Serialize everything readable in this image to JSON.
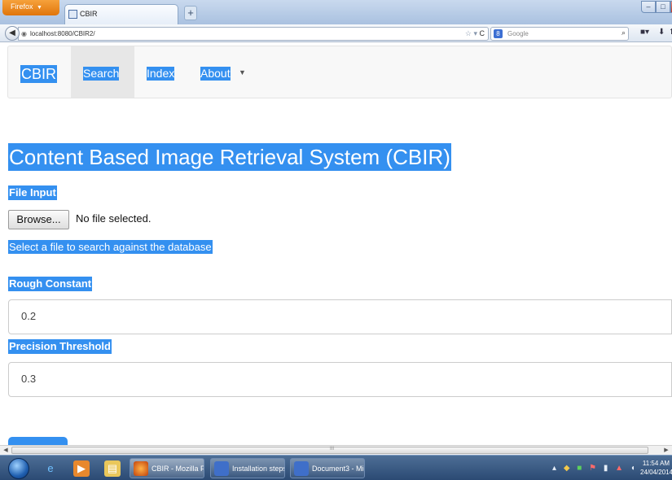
{
  "browser": {
    "app_button_label": "Firefox",
    "tab_title": "CBIR",
    "new_tab_label": "+",
    "url": "localhost:8080/CBIR2/",
    "search_engine_badge": "8",
    "search_placeholder": "Google",
    "icons": [
      "back-icon",
      "globe-icon",
      "star-icon",
      "reload-icon",
      "search-icon",
      "bookmarks-icon",
      "download-icon"
    ]
  },
  "site_nav": {
    "brand": "CBIR",
    "items": [
      {
        "label": "Search",
        "active": true
      },
      {
        "label": "Index",
        "active": false
      },
      {
        "label": "About",
        "active": false,
        "dropdown": true
      }
    ]
  },
  "main": {
    "heading": "Content Based Image Retrieval System (CBIR)",
    "file_input": {
      "label": "File Input",
      "button_label": "Browse...",
      "status": "No file selected.",
      "help": "Select a file to search against the database"
    },
    "rough_constant": {
      "label": "Rough Constant",
      "value": "0.2"
    },
    "precision_threshold": {
      "label": "Precision Threshold",
      "value": "0.3"
    }
  },
  "scrollbar": {
    "grip": "III"
  },
  "taskbar": {
    "tasks": [
      {
        "label": "CBIR - Mozilla Fir...",
        "icon": "firefox-icon"
      },
      {
        "label": "Installation steps ...",
        "icon": "word-icon"
      },
      {
        "label": "Document3 - Mic...",
        "icon": "word-icon"
      }
    ],
    "clock_time": "11:54 AM",
    "clock_date": "24/04/2014"
  },
  "colors": {
    "highlight": "#3490f0",
    "nav_bg": "#f8f8f8",
    "taskbar": "#2b4a73"
  }
}
